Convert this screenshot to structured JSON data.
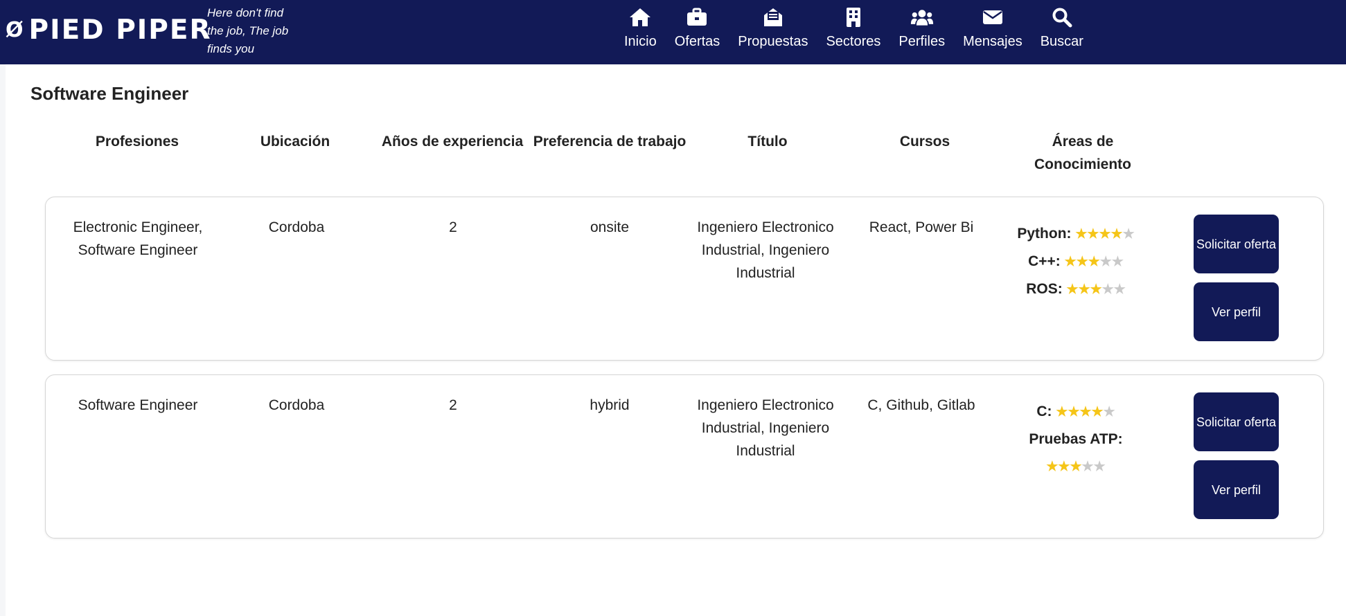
{
  "brand": {
    "mark": "Ø",
    "name": "PIED PIPER",
    "tagline": "Here don't find the job, The job finds you"
  },
  "nav": [
    {
      "label": "Inicio",
      "icon": "home-icon"
    },
    {
      "label": "Ofertas",
      "icon": "briefcase-icon"
    },
    {
      "label": "Propuestas",
      "icon": "envelope-open-icon"
    },
    {
      "label": "Sectores",
      "icon": "building-icon"
    },
    {
      "label": "Perfiles",
      "icon": "users-icon"
    },
    {
      "label": "Mensajes",
      "icon": "envelope-icon"
    },
    {
      "label": "Buscar",
      "icon": "search-icon"
    }
  ],
  "page": {
    "title": "Software Engineer"
  },
  "table": {
    "headers": [
      "Profesiones",
      "Ubicación",
      "Años de experiencia",
      "Preferencia de trabajo",
      "Título",
      "Cursos",
      "Áreas de Conocimiento"
    ],
    "rows": [
      {
        "profesiones": "Electronic Engineer, Software Engineer",
        "ubicacion": "Cordoba",
        "experiencia": "2",
        "preferencia": "onsite",
        "titulo": "Ingeniero Electronico Industrial, Ingeniero Industrial",
        "cursos": "React, Power Bi",
        "areas": [
          {
            "name": "Python:",
            "rating": 4,
            "max": 5
          },
          {
            "name": "C++:",
            "rating": 3,
            "max": 5
          },
          {
            "name": "ROS:",
            "rating": 3,
            "max": 5
          }
        ],
        "actions": {
          "apply": "Solicitar oferta",
          "profile": "Ver perfil"
        }
      },
      {
        "profesiones": "Software Engineer",
        "ubicacion": "Cordoba",
        "experiencia": "2",
        "preferencia": "hybrid",
        "titulo": "Ingeniero Electronico Industrial, Ingeniero Industrial",
        "cursos": "C, Github, Gitlab",
        "areas": [
          {
            "name": "C:",
            "rating": 4,
            "max": 5
          },
          {
            "name": "Pruebas ATP:",
            "rating": 3,
            "max": 5
          }
        ],
        "actions": {
          "apply": "Solicitar oferta",
          "profile": "Ver perfil"
        }
      }
    ]
  },
  "colors": {
    "navbar": "#121a57",
    "button": "#121a57",
    "star_on": "#f5c518",
    "star_off": "#c9c9c9"
  }
}
